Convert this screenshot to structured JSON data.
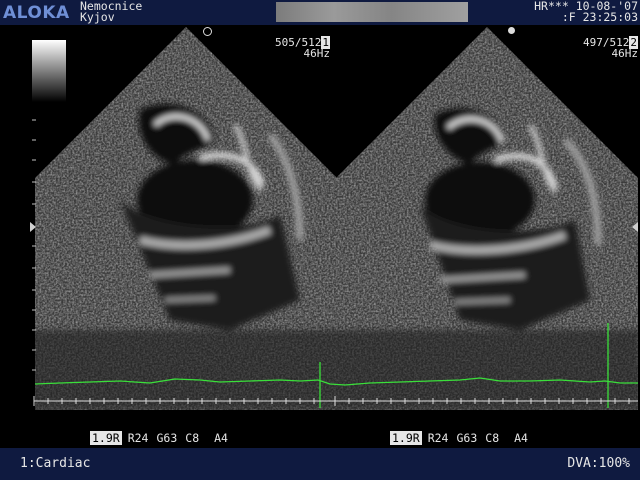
{
  "header": {
    "logo": "ALOKA",
    "hospital_line1": "Nemocnice",
    "hospital_line2": "Kyjov",
    "hr": "HR***",
    "date": "10-08-'07",
    "time": ":F 23:25:03"
  },
  "left_image": {
    "frame": "505/512",
    "frame_box": "1",
    "frame_rate": "46Hz",
    "depth": "1.9R",
    "rejection": "R24",
    "gain": "G63",
    "contrast": "C8",
    "acoustic": "A4"
  },
  "right_image": {
    "frame": "497/512",
    "frame_box": "2",
    "frame_rate": "46Hz",
    "depth": "1.9R",
    "rejection": "R24",
    "gain": "G63",
    "contrast": "C8",
    "acoustic": "A4"
  },
  "footer": {
    "preset": "1:Cardiac",
    "dva": "DVA:100%"
  },
  "colors": {
    "ecg": "#3adf3a",
    "header_bg": "#0f1a40",
    "logo": "#6f8fd6"
  }
}
